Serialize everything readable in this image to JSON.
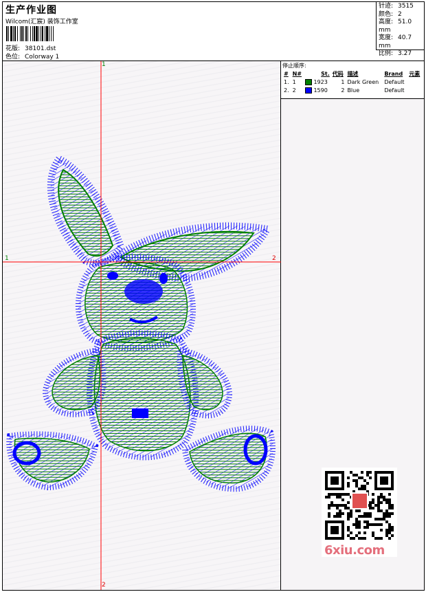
{
  "header": {
    "title": "生产作业图",
    "subtitle": "Wilcom(汇宸) 装饰工作室",
    "design_label": "花版:",
    "design_value": "38101.dst",
    "colorway_label": "色位:",
    "colorway_value": "Colorway 1"
  },
  "stats": {
    "stitches_label": "针迹:",
    "stitches_value": "3515",
    "colors_label": "颜色:",
    "colors_value": "2",
    "height_label": "高度:",
    "height_value": "51.0 mm",
    "width_label": "宽度:",
    "width_value": "40.7 mm",
    "scale_label": "比例:",
    "scale_value": "3.27"
  },
  "axes": {
    "top": "1",
    "left": "1",
    "right": "2",
    "bottom": "2"
  },
  "stop_sequence": {
    "title": "停止顺序:",
    "headers": [
      "#",
      "N#",
      "St.",
      "代码",
      "描述",
      "Brand",
      "元素"
    ],
    "rows": [
      {
        "idx": "1.",
        "needle": "1",
        "color": "#008000",
        "stitches": "1923",
        "code": "1",
        "desc": "Dark Green",
        "brand": "Default"
      },
      {
        "idx": "2.",
        "needle": "2",
        "color": "#0000ff",
        "stitches": "1590",
        "code": "2",
        "desc": "Blue",
        "brand": "Default"
      }
    ]
  },
  "colors": {
    "thread1": "#008000",
    "thread2": "#0000ff",
    "crosshair": "#ff0000"
  },
  "watermark": {
    "logo_text": "6xiu.com"
  }
}
